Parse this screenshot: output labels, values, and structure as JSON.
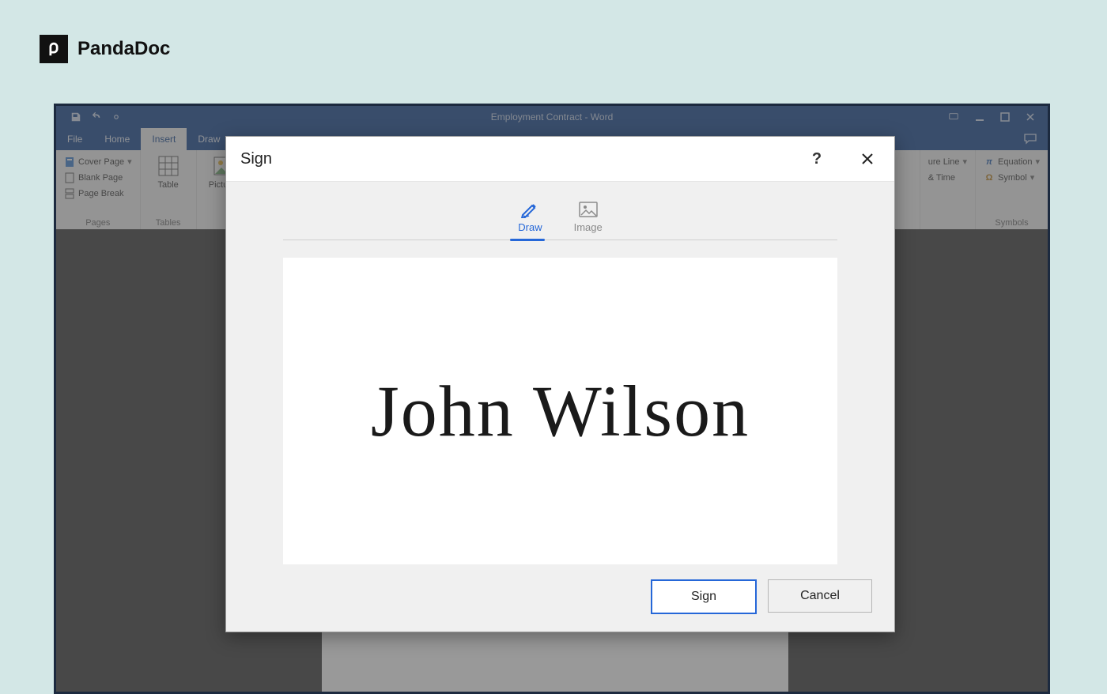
{
  "brand": {
    "name": "PandaDoc"
  },
  "word": {
    "title": "Employment Contract - Word",
    "menu": {
      "file": "File",
      "home": "Home",
      "insert": "Insert",
      "draw": "Draw"
    },
    "ribbon": {
      "pages_group": "Pages",
      "tables_group": "Tables",
      "symbols_group": "Symbols",
      "cover_page": "Cover Page",
      "blank_page": "Blank Page",
      "page_break": "Page Break",
      "table": "Table",
      "pictures": "Pictures",
      "signature_line": "ure Line",
      "date_time": "& Time",
      "equation": "Equation",
      "symbol": "Symbol"
    }
  },
  "dialog": {
    "title": "Sign",
    "tabs": {
      "draw": "Draw",
      "image": "Image"
    },
    "signature_text": "John Wilson",
    "buttons": {
      "sign": "Sign",
      "cancel": "Cancel"
    }
  }
}
